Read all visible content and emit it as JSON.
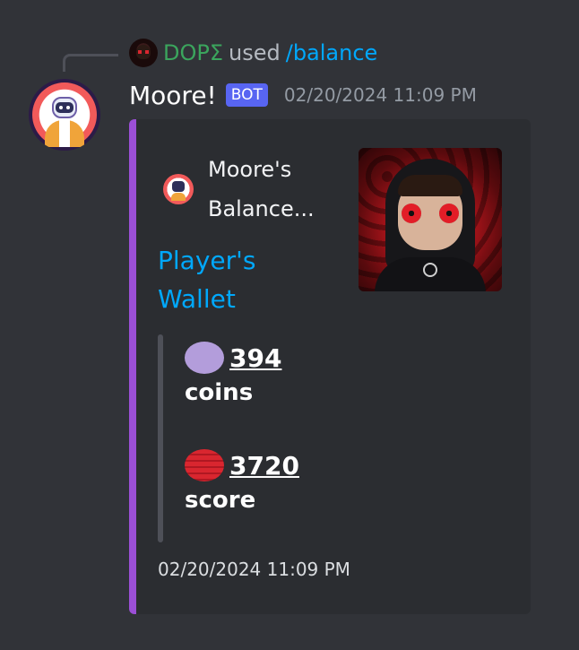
{
  "reply": {
    "user": "DOPΣ",
    "used_text": "used",
    "command": "/balance"
  },
  "message": {
    "username": "Moore!",
    "bot_tag": "BOT",
    "timestamp": "02/20/2024 11:09 PM"
  },
  "embed": {
    "accent_color": "#9b4fd6",
    "author_name": "Moore's Balance...",
    "title": "Player's Wallet",
    "fields": [
      {
        "emoji": "purple-circle-icon",
        "value": "394",
        "label": "coins"
      },
      {
        "emoji": "red-striped-circle-icon",
        "value": "3720",
        "label": "score"
      }
    ],
    "footer_timestamp": "02/20/2024 11:09 PM"
  },
  "colors": {
    "background": "#313338",
    "embed_background": "#2b2d31",
    "link_blue": "#00a8fc",
    "reply_user_green": "#3ba55d",
    "bot_tag": "#5865f2"
  }
}
